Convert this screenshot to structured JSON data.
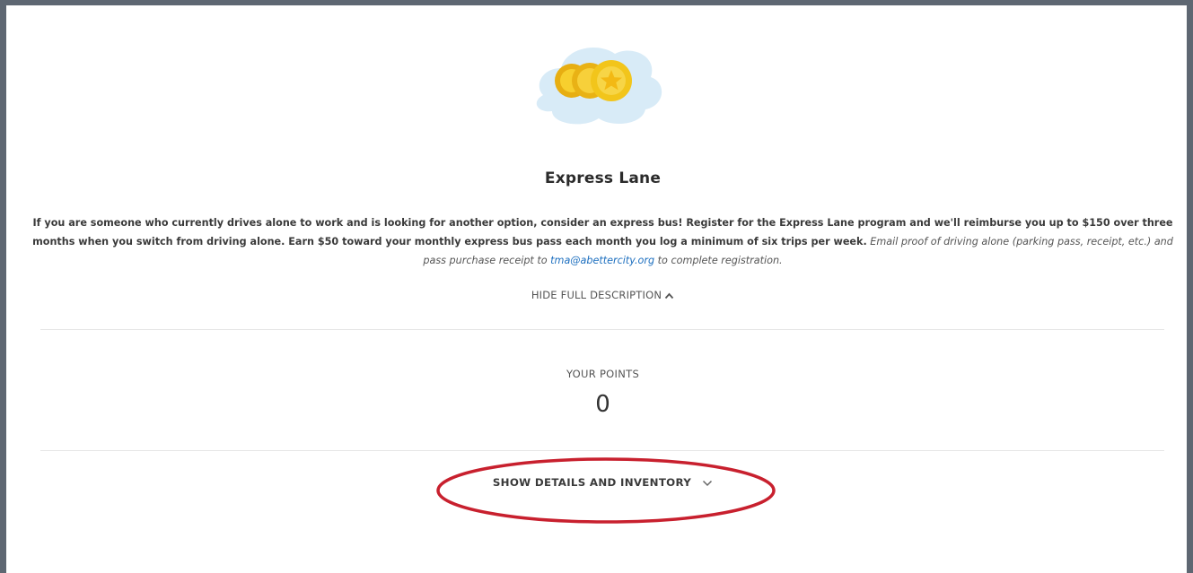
{
  "card": {
    "title": "Express Lane",
    "description": {
      "part1": "If you are someone who currently drives alone to work and is looking for another option, consider an express bus! Register for the Express Lane program and we'll reimburse you up to $150 over three months when you switch from driving alone. Earn $50 toward your monthly express bus pass each month you log a minimum of six trips per week.",
      "part2": "Email proof of driving alone (parking pass, receipt, etc.) and pass purchase receipt to",
      "email": "tma@abettercity.org",
      "part3": "to complete registration."
    },
    "hide_description_label": "HIDE FULL DESCRIPTION",
    "points": {
      "label": "YOUR POINTS",
      "value": "0"
    },
    "show_details_label": "SHOW DETAILS AND INVENTORY"
  },
  "icons": {
    "hero": "coins-illustration",
    "hide_chevron": "chevron-up-icon",
    "show_chevron": "chevron-down-icon"
  },
  "colors": {
    "frame_border": "#5e6772",
    "link": "#1d6fbf",
    "highlight_ring": "#c8202e",
    "coin": "#f2c51b",
    "cloud": "#d8ebf7"
  }
}
